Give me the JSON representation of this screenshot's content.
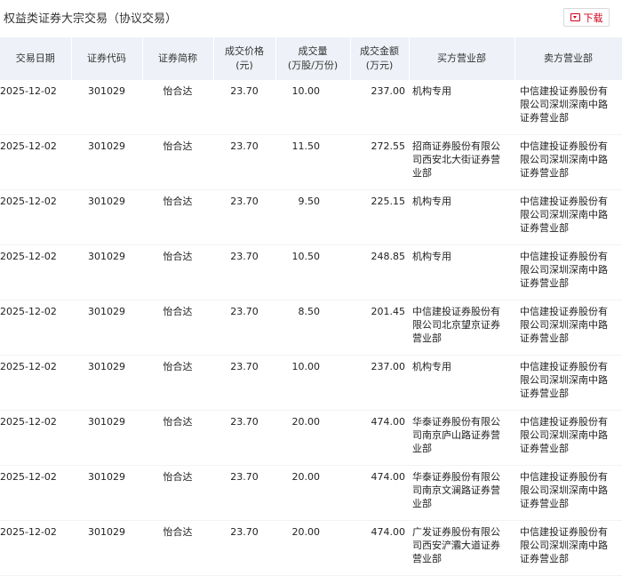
{
  "page": {
    "title": "权益类证券大宗交易（协议交易）",
    "download_label": "下载"
  },
  "table": {
    "headers": {
      "date": "交易日期",
      "code": "证券代码",
      "name": "证券简称",
      "price_line1": "成交价格",
      "price_line2": "(元)",
      "volume_line1": "成交量",
      "volume_line2": "(万股/万份)",
      "amount_line1": "成交金额",
      "amount_line2": "(万元)",
      "buyer": "买方营业部",
      "seller": "卖方营业部"
    },
    "rows": [
      {
        "date": "2025-12-02",
        "code": "301029",
        "name": "怡合达",
        "price": "23.70",
        "volume": "10.00",
        "amount": "237.00",
        "buyer": "机构专用",
        "seller": "中信建投证券股份有限公司深圳深南中路证券营业部"
      },
      {
        "date": "2025-12-02",
        "code": "301029",
        "name": "怡合达",
        "price": "23.70",
        "volume": "11.50",
        "amount": "272.55",
        "buyer": "招商证券股份有限公司西安北大街证券营业部",
        "seller": "中信建投证券股份有限公司深圳深南中路证券营业部"
      },
      {
        "date": "2025-12-02",
        "code": "301029",
        "name": "怡合达",
        "price": "23.70",
        "volume": "9.50",
        "amount": "225.15",
        "buyer": "机构专用",
        "seller": "中信建投证券股份有限公司深圳深南中路证券营业部"
      },
      {
        "date": "2025-12-02",
        "code": "301029",
        "name": "怡合达",
        "price": "23.70",
        "volume": "10.50",
        "amount": "248.85",
        "buyer": "机构专用",
        "seller": "中信建投证券股份有限公司深圳深南中路证券营业部"
      },
      {
        "date": "2025-12-02",
        "code": "301029",
        "name": "怡合达",
        "price": "23.70",
        "volume": "8.50",
        "amount": "201.45",
        "buyer": "中信建投证券股份有限公司北京望京证券营业部",
        "seller": "中信建投证券股份有限公司深圳深南中路证券营业部"
      },
      {
        "date": "2025-12-02",
        "code": "301029",
        "name": "怡合达",
        "price": "23.70",
        "volume": "10.00",
        "amount": "237.00",
        "buyer": "机构专用",
        "seller": "中信建投证券股份有限公司深圳深南中路证券营业部"
      },
      {
        "date": "2025-12-02",
        "code": "301029",
        "name": "怡合达",
        "price": "23.70",
        "volume": "20.00",
        "amount": "474.00",
        "buyer": "华泰证券股份有限公司南京庐山路证券营业部",
        "seller": "中信建投证券股份有限公司深圳深南中路证券营业部"
      },
      {
        "date": "2025-12-02",
        "code": "301029",
        "name": "怡合达",
        "price": "23.70",
        "volume": "20.00",
        "amount": "474.00",
        "buyer": "华泰证券股份有限公司南京文澜路证券营业部",
        "seller": "中信建投证券股份有限公司深圳深南中路证券营业部"
      },
      {
        "date": "2025-12-02",
        "code": "301029",
        "name": "怡合达",
        "price": "23.70",
        "volume": "20.00",
        "amount": "474.00",
        "buyer": "广发证券股份有限公司西安浐灞大道证券营业部",
        "seller": "中信建投证券股份有限公司深圳深南中路证券营业部"
      }
    ]
  },
  "colors": {
    "header_bg": "#eef1f7",
    "accent_red": "#d0021b",
    "text": "#222222"
  },
  "icons": {
    "download": "download-icon"
  }
}
